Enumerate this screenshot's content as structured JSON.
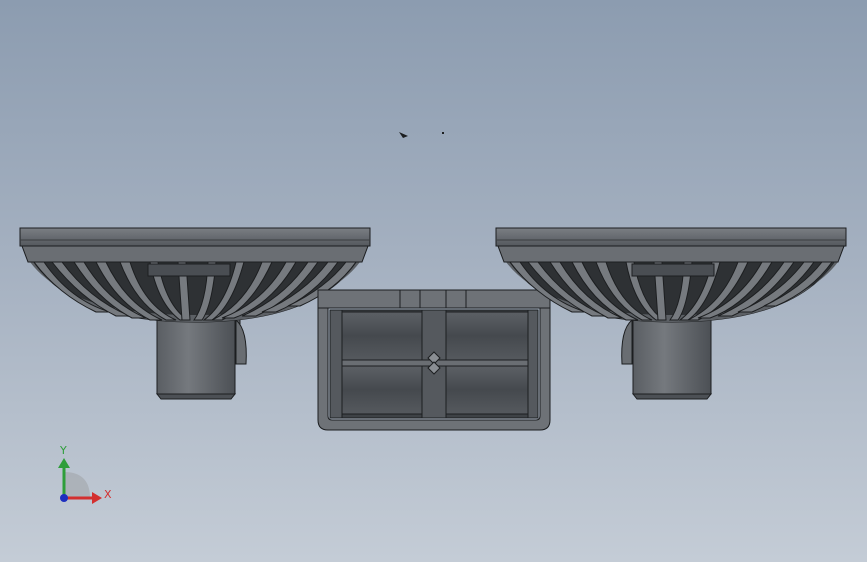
{
  "viewport": {
    "view": "front"
  },
  "model": {
    "parts": [
      "left-basket",
      "right-basket",
      "center-holder"
    ]
  },
  "triad": {
    "y_label": "Y",
    "x_label": "X",
    "colors": {
      "x": "#d32f2f",
      "y": "#2e9e3a",
      "z": "#1e2fbf"
    }
  },
  "colors": {
    "part_dark": "#4e5257",
    "part_mid": "#6a6e73",
    "part_light": "#868a8f",
    "edge": "#1c1e20"
  }
}
